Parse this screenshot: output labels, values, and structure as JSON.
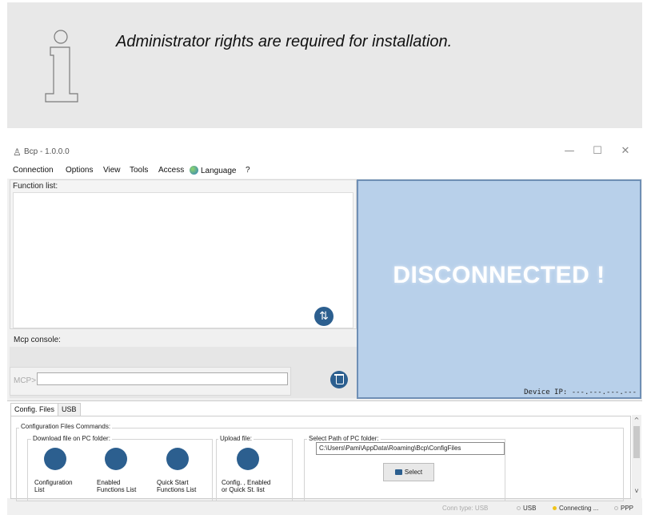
{
  "info": {
    "message": "Administrator rights are required for installation."
  },
  "window": {
    "title": "Bcp - 1.0.0.0",
    "minimize": "—",
    "maximize": "☐",
    "close": "✕"
  },
  "menu": {
    "items": [
      "Connection",
      "Options",
      "View",
      "Tools",
      "Access",
      "Language",
      "?"
    ]
  },
  "function_list": {
    "label": "Function list:"
  },
  "console": {
    "label": "Mcp console:",
    "prompt": "MCP>",
    "input_value": ""
  },
  "device": {
    "status": "DISCONNECTED !",
    "ip_text": "Device IP: ---.---.---.---"
  },
  "tabs": [
    "Config. Files",
    "USB"
  ],
  "config": {
    "group_title": "Configuration Files Commands:",
    "download_title": "Download file on PC folder:",
    "upload_title": "Upload file:",
    "select_path_title": "Select Path of PC folder:",
    "buttons": {
      "configuration_list": [
        "Configuration",
        "List"
      ],
      "enabled_functions": [
        "Enabled",
        "Functions List"
      ],
      "quick_start": [
        "Quick Start",
        "Functions List"
      ],
      "upload": [
        "Config. , Enabled",
        "or Quick St. list"
      ]
    },
    "path_value": "C:\\Users\\Pami\\AppData\\Roaming\\Bcp\\ConfigFiles",
    "select_label": "Select"
  },
  "status": {
    "conn_type": "Conn type: USB",
    "usb": "USB",
    "connecting": "Connecting ...",
    "ppp": "PPP",
    "colors": {
      "usb": "#cfcfcf",
      "connecting": "#f0c419",
      "ppp": "#cfcfcf"
    }
  },
  "icons": {
    "info": "info-icon",
    "refresh": "refresh-icon",
    "trash": "trash-icon",
    "globe": "globe-icon",
    "folder": "folder-icon"
  }
}
